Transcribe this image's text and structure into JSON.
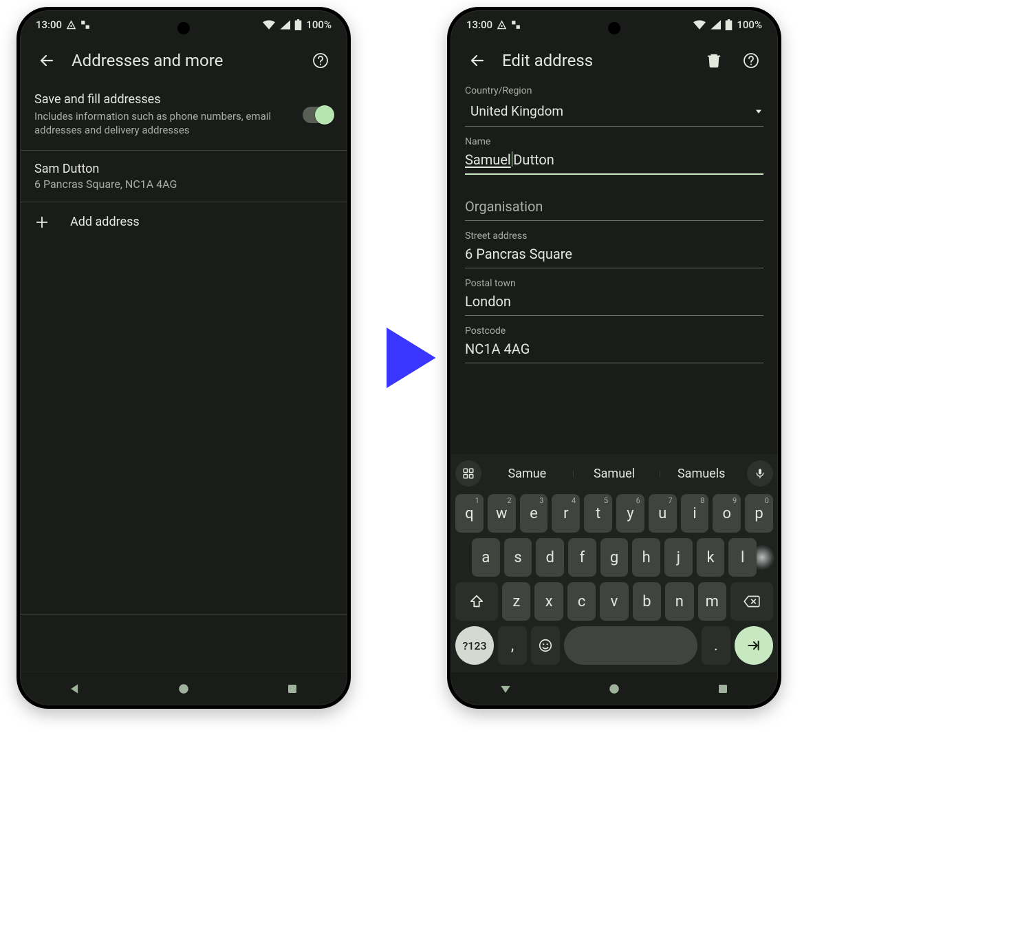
{
  "status": {
    "time": "13:00",
    "battery": "100%"
  },
  "left": {
    "title": "Addresses and more",
    "save_fill": {
      "title": "Save and fill addresses",
      "sub": "Includes information such as phone numbers, email addresses and delivery addresses",
      "on": true
    },
    "address": {
      "name": "Sam Dutton",
      "line": "6 Pancras Square, NC1A 4AG"
    },
    "add_label": "Add address"
  },
  "right": {
    "title": "Edit address",
    "country_label": "Country/Region",
    "country_value": "United Kingdom",
    "name_label": "Name",
    "name_value_a": "Samuel",
    "name_value_b": "Dutton",
    "org_label": "Organisation",
    "org_placeholder": "Organisation",
    "street_label": "Street address",
    "street_value": "6 Pancras Square",
    "town_label": "Postal town",
    "town_value": "London",
    "postcode_label": "Postcode",
    "postcode_value": "NC1A 4AG"
  },
  "kbd": {
    "suggestions": [
      "Samue",
      "Samuel",
      "Samuels"
    ],
    "row1": [
      "q",
      "w",
      "e",
      "r",
      "t",
      "y",
      "u",
      "i",
      "o",
      "p"
    ],
    "hints1": [
      "1",
      "2",
      "3",
      "4",
      "5",
      "6",
      "7",
      "8",
      "9",
      "0"
    ],
    "row2": [
      "a",
      "s",
      "d",
      "f",
      "g",
      "h",
      "j",
      "k",
      "l"
    ],
    "row3": [
      "z",
      "x",
      "c",
      "v",
      "b",
      "n",
      "m"
    ],
    "numkey": "?123",
    "comma": ",",
    "period": "."
  }
}
